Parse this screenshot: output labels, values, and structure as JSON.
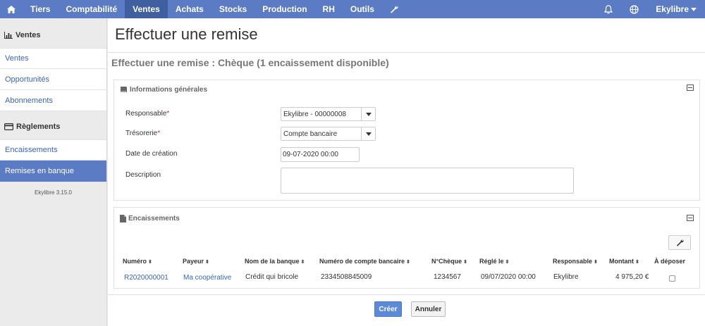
{
  "topnav": {
    "home_icon": "home-icon",
    "items": [
      "Tiers",
      "Comptabilité",
      "Ventes",
      "Achats",
      "Stocks",
      "Production",
      "RH",
      "Outils"
    ],
    "active": "Ventes",
    "tools_icon": "wrench-icon",
    "bell_icon": "bell-icon",
    "globe_icon": "globe-icon",
    "user": "Ekylibre"
  },
  "sidebar": {
    "section1": "Ventes",
    "links1": [
      "Ventes",
      "Opportunités",
      "Abonnements"
    ],
    "section2": "Règlements",
    "links2": [
      "Encaissements",
      "Remises en banque"
    ],
    "active": "Remises en banque",
    "version": "Ekylibre 3.15.0"
  },
  "page": {
    "title": "Effectuer une remise",
    "subtitle": "Effectuer une remise : Chèque (1 encaissement disponible)"
  },
  "general": {
    "heading": "Informations générales",
    "responsable_label": "Responsable",
    "responsable_value": "Ekylibre - 00000008",
    "tresorerie_label": "Trésorerie",
    "tresorerie_value": "Compte bancaire",
    "date_label": "Date de création",
    "date_value": "09-07-2020 00:00",
    "description_label": "Description",
    "required_mark": "*"
  },
  "encaissements": {
    "heading": "Encaissements",
    "columns": [
      "Numéro",
      "Payeur",
      "Nom de la banque",
      "Numéro de compte bancaire",
      "N°Chèque",
      "Réglé le",
      "Responsable",
      "Montant",
      "À déposer"
    ],
    "sort_glyph": "⬍",
    "row": {
      "numero": "R2020000001",
      "payeur": "Ma coopérative",
      "banque": "Crédit qui bricole",
      "compte": "2334508845009",
      "cheque": "1234567",
      "regle_le": "09/07/2020 00:00",
      "responsable": "Ekylibre",
      "montant": "4 975,20 €",
      "a_deposer": false
    }
  },
  "actions": {
    "create": "Créer",
    "cancel": "Annuler"
  },
  "colors": {
    "nav_bg": "#5b7cc4",
    "nav_active": "#3f5f9e",
    "link": "#3a64b8",
    "primary_button": "#5b8ad6"
  }
}
